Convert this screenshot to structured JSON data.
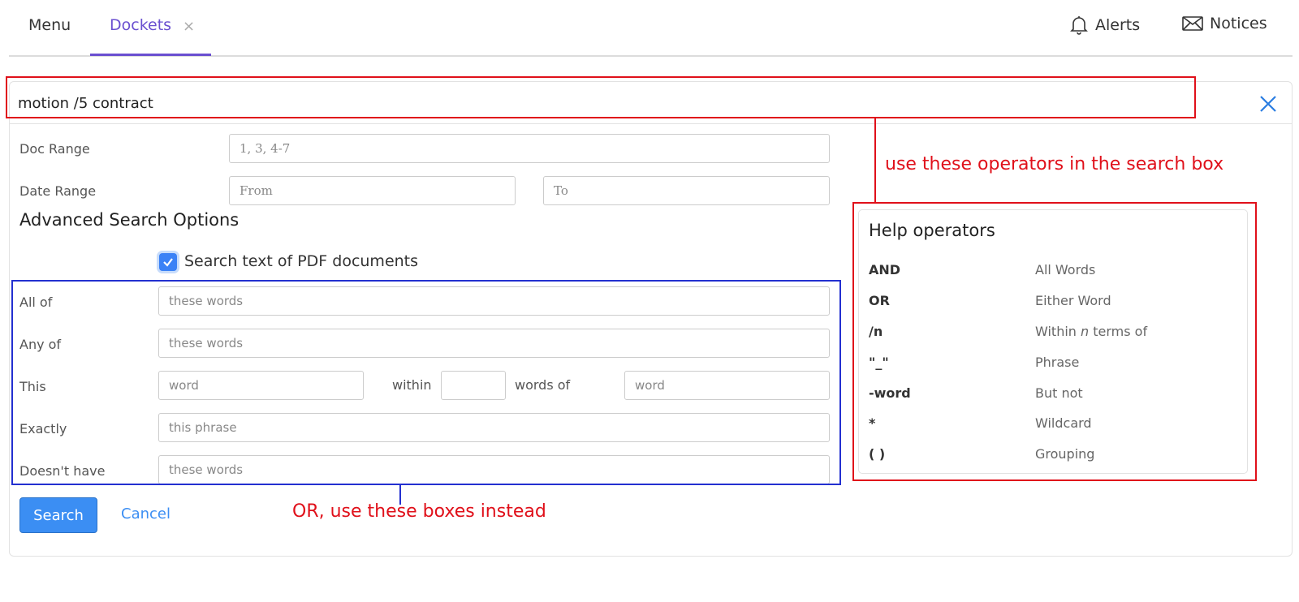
{
  "nav": {
    "menu_label": "Menu",
    "dockets_label": "Dockets",
    "close_glyph": "×",
    "alerts_label": "Alerts",
    "notices_label": "Notices",
    "active_color": "#6a4fd0"
  },
  "search": {
    "query": "motion /5 contract"
  },
  "form": {
    "doc_range_label": "Doc Range",
    "doc_range_placeholder": "1, 3, 4-7",
    "date_range_label": "Date Range",
    "date_from_placeholder": "From",
    "date_to_placeholder": "To",
    "advanced_title": "Advanced Search Options",
    "pdf_checkbox_label": "Search text of PDF documents",
    "pdf_checked": true,
    "all_of_label": "All of",
    "all_of_placeholder": "these words",
    "any_of_label": "Any of",
    "any_of_placeholder": "these words",
    "this_label": "This",
    "this_placeholder": "word",
    "within_label": "within",
    "words_of_label": "words of",
    "words_of_placeholder": "word",
    "exactly_label": "Exactly",
    "exactly_placeholder": "this phrase",
    "doesnt_have_label": "Doesn't have",
    "doesnt_have_placeholder": "these words",
    "search_button": "Search",
    "cancel_button": "Cancel",
    "accent_color": "#3b8ef3"
  },
  "help": {
    "title": "Help operators",
    "operators": [
      {
        "key": "AND",
        "desc": "All Words"
      },
      {
        "key": "OR",
        "desc": "Either Word"
      },
      {
        "key": "/n",
        "desc_pre": "Within ",
        "desc_em": "n",
        "desc_post": " terms of"
      },
      {
        "key": "\"_\"",
        "desc": "Phrase"
      },
      {
        "key": "-word",
        "desc": "But not"
      },
      {
        "key": "*",
        "desc": "Wildcard"
      },
      {
        "key": "( )",
        "desc": "Grouping"
      }
    ]
  },
  "annotations": {
    "operators_note": "use these operators in the search box",
    "boxes_note": "OR, use these boxes instead",
    "red_color": "#e0101a",
    "blue_color": "#2330d0"
  }
}
